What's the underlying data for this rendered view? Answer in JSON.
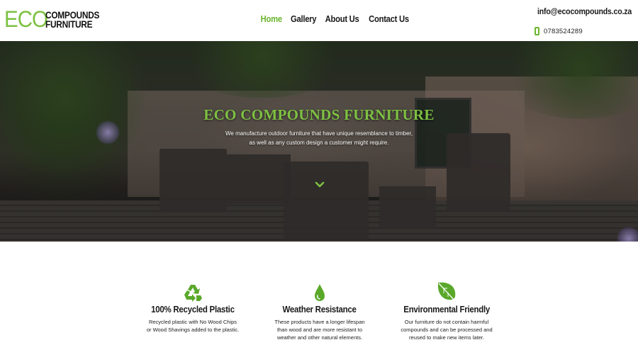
{
  "brand": {
    "logo_eco": "ECO",
    "logo_line1": "COMPOUNDS",
    "logo_line2": "FURNITURE",
    "accent_color": "#6bb52e"
  },
  "nav": {
    "items": [
      {
        "label": "Home",
        "active": true
      },
      {
        "label": "Gallery",
        "active": false
      },
      {
        "label": "About Us",
        "active": false
      },
      {
        "label": "Contact Us",
        "active": false
      }
    ]
  },
  "contact": {
    "email": "info@ecocompounds.co.za",
    "phone": "0783524289",
    "email_icon": "envelope-icon",
    "phone_icon": "mobile-phone-icon"
  },
  "hero": {
    "title": "ECO COMPOUNDS FURNITURE",
    "subtitle_line1": "We manufacture outdoor furniture that have unique resemblance to timber,",
    "subtitle_line2": "as well as any custom design a customer might require.",
    "scroll_icon": "chevron-down-icon"
  },
  "features": [
    {
      "icon": "recycle-icon",
      "title": "100% Recycled Plastic",
      "description": "Recycled plastic with No Wood Chips\nor Wood Shavings added to the plastic."
    },
    {
      "icon": "water-drop-icon",
      "title": "Weather Resistance",
      "description": "These products have a longer lifespan\nthan wood and are more resistant to\nweather and other natural elements."
    },
    {
      "icon": "leaf-icon",
      "title": "Environmental Friendly",
      "description": "Our furniture do not contain harmful\ncompounds and can be processed and\nreused to make new items later."
    }
  ]
}
